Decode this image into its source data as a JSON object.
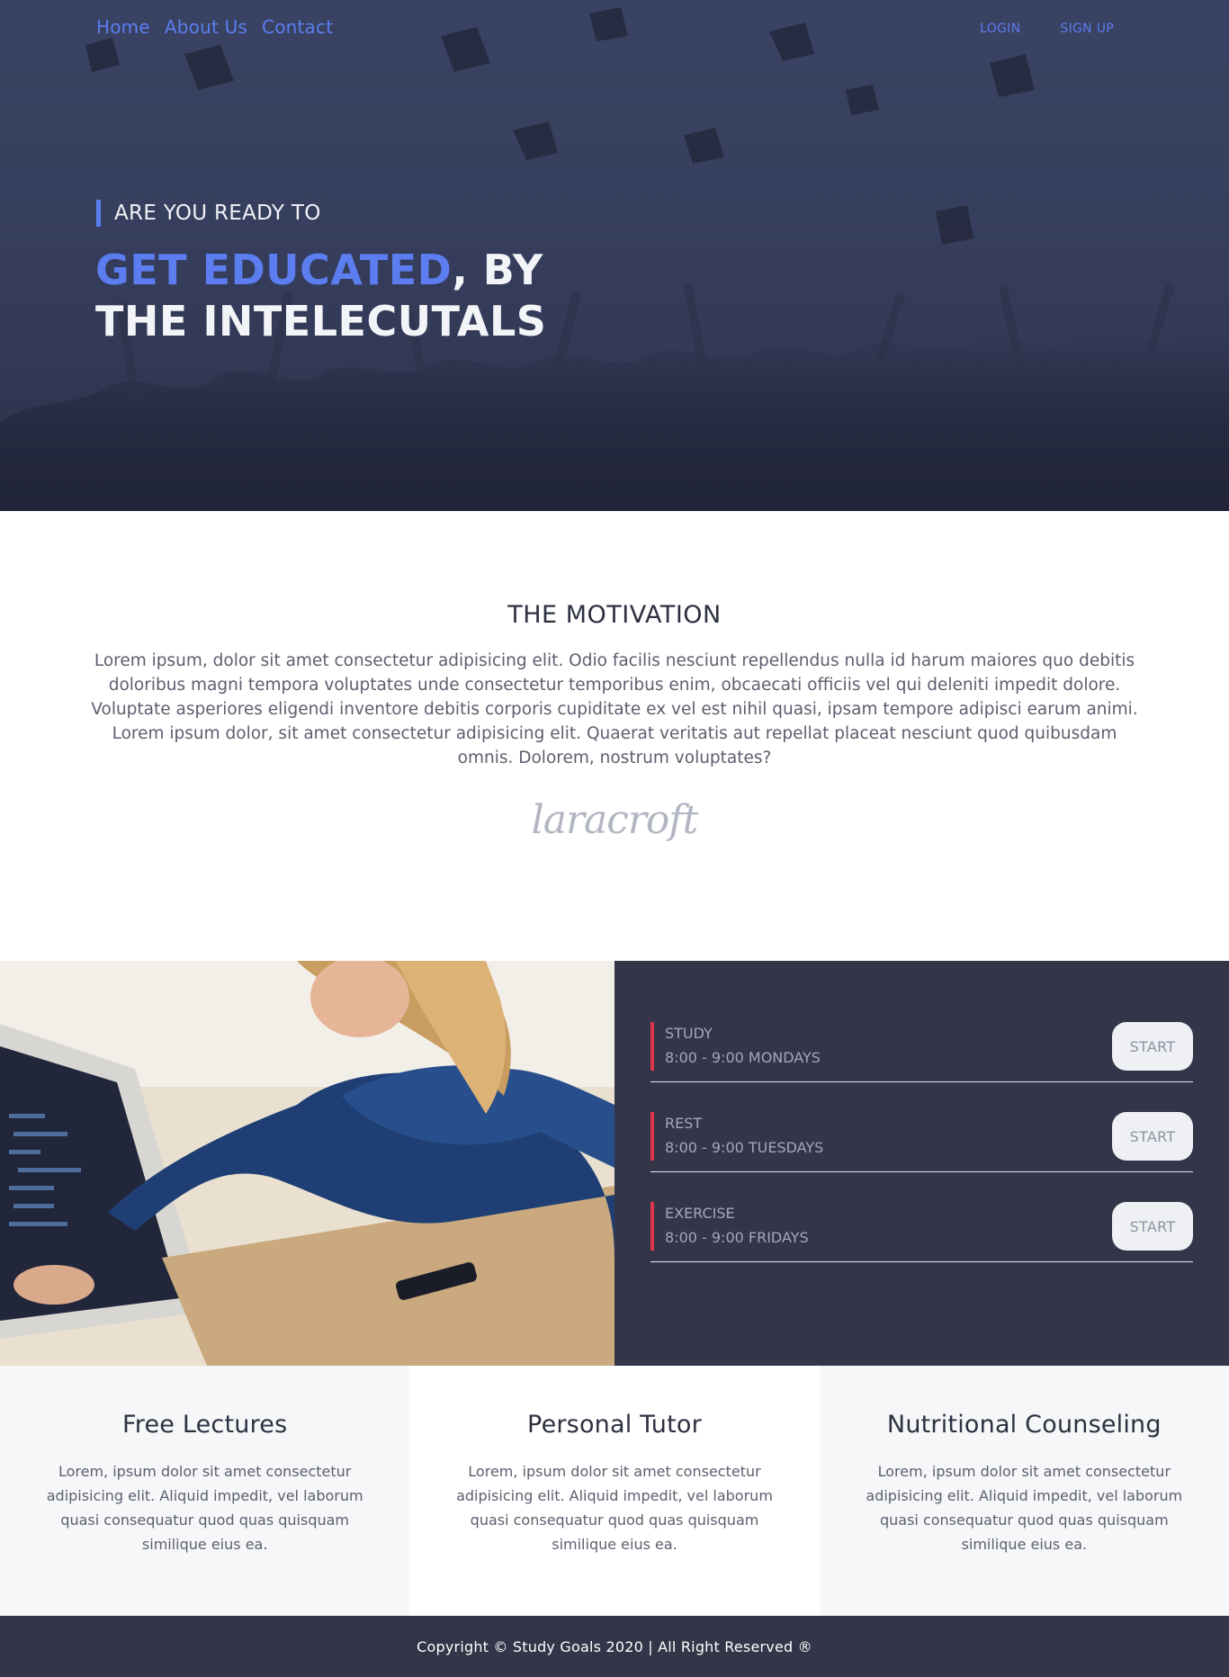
{
  "nav": {
    "links": [
      "Home",
      "About Us",
      "Contact"
    ],
    "login": "LOGIN",
    "signup": "SIGN UP"
  },
  "hero": {
    "kicker": "ARE YOU READY TO",
    "headline_accent": "GET EDUCATED",
    "headline_rest_1": ", BY",
    "headline_line_2": "THE INTELECUTALS"
  },
  "motivation": {
    "title": "THE MOTIVATION",
    "body": "Lorem ipsum, dolor sit amet consectetur adipisicing elit. Odio facilis nesciunt repellendus nulla id harum maiores quo debitis doloribus magni tempora voluptates unde consectetur temporibus enim, obcaecati officiis vel qui deleniti impedit dolore. Voluptate asperiores eligendi inventore debitis corporis cupiditate ex vel est nihil quasi, ipsam tempore adipisci earum animi. Lorem ipsum dolor, sit amet consectetur adipisicing elit. Quaerat veritatis aut repellat placeat nesciunt quod quibusdam omnis. Dolorem, nostrum voluptates?",
    "signature": "laracroft"
  },
  "schedule": {
    "items": [
      {
        "name": "STUDY",
        "time": "8:00 - 9:00 MONDAYS",
        "button": "START"
      },
      {
        "name": "REST",
        "time": "8:00 - 9:00 TUESDAYS",
        "button": "START"
      },
      {
        "name": "EXERCISE",
        "time": "8:00 - 9:00 FRIDAYS",
        "button": "START"
      }
    ]
  },
  "services": [
    {
      "title": "Free Lectures",
      "text": "Lorem, ipsum dolor sit amet consectetur adipisicing elit. Aliquid impedit, vel laborum quasi consequatur quod quas quisquam similique eius ea."
    },
    {
      "title": "Personal Tutor",
      "text": "Lorem, ipsum dolor sit amet consectetur adipisicing elit. Aliquid impedit, vel laborum quasi consequatur quod quas quisquam similique eius ea."
    },
    {
      "title": "Nutritional Counseling",
      "text": "Lorem, ipsum dolor sit amet consectetur adipisicing elit. Aliquid impedit, vel laborum quasi consequatur quod quas quisquam similique eius ea."
    }
  ],
  "footer": {
    "copyright": "Copyright © Study Goals 2020 | All Right Reserved ®"
  },
  "colors": {
    "accent": "#5b7df0",
    "dark_panel": "#333548",
    "marker_red": "#e0344c"
  }
}
